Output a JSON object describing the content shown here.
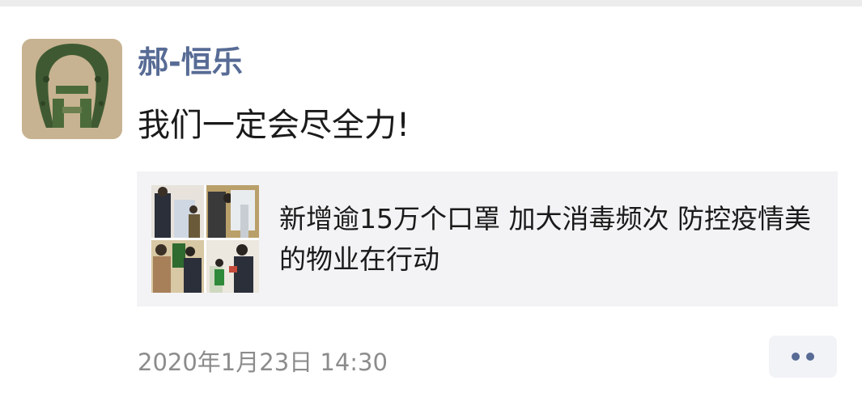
{
  "moment": {
    "author": "郝-恒乐",
    "text": "我们一定会尽全力!",
    "link": {
      "title": "新增逾15万个口罩 加大消毒频次 防控疫情美的物业在行动"
    },
    "timestamp": "2020年1月23日 14:30",
    "more_icon": "more-dots-icon",
    "colors": {
      "author": "#576b95",
      "card_background": "#f3f3f5",
      "timestamp": "#8c8c8c"
    }
  }
}
